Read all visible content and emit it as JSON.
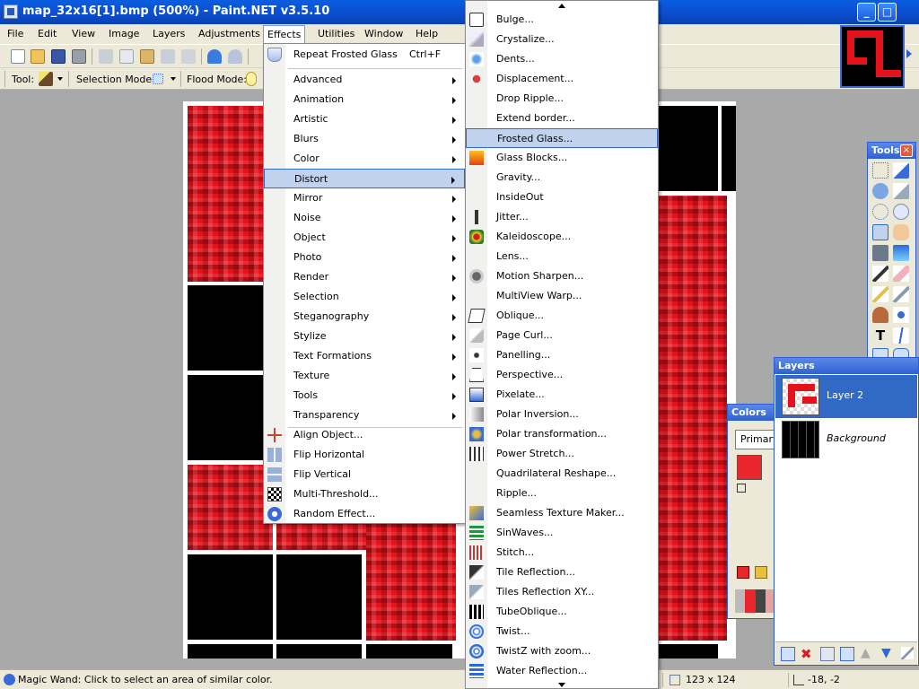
{
  "window": {
    "title": "map_32x16[1].bmp (500%) - Paint.NET v3.5.10",
    "minimize": "_",
    "maximize": "□"
  },
  "menubar": [
    "File",
    "Edit",
    "View",
    "Image",
    "Layers",
    "Adjustments",
    "Effects",
    "Utilities",
    "Window",
    "Help"
  ],
  "toolbar": {
    "tool_label": "Tool:",
    "selection_mode_label": "Selection Mode:",
    "flood_mode_label": "Flood Mode:"
  },
  "effects_menu": {
    "repeat": {
      "label": "Repeat Frosted Glass",
      "shortcut": "Ctrl+F"
    },
    "submenus": [
      "Advanced",
      "Animation",
      "Artistic",
      "Blurs",
      "Color",
      "Distort",
      "Mirror",
      "Noise",
      "Object",
      "Photo",
      "Render",
      "Selection",
      "Steganography",
      "Stylize",
      "Text Formations",
      "Texture",
      "Tools",
      "Transparency"
    ],
    "items": [
      "Align Object...",
      "Flip Horizontal",
      "Flip Vertical",
      "Multi-Threshold...",
      "Random Effect..."
    ],
    "highlighted": "Distort"
  },
  "distort_menu": {
    "items": [
      "Bulge...",
      "Crystalize...",
      "Dents...",
      "Displacement...",
      "Drop Ripple...",
      "Extend border...",
      "Frosted Glass...",
      "Glass Blocks...",
      "Gravity...",
      "InsideOut",
      "Jitter...",
      "Kaleidoscope...",
      "Lens...",
      "Motion Sharpen...",
      "MultiView Warp...",
      "Oblique...",
      "Page Curl...",
      "Panelling...",
      "Perspective...",
      "Pixelate...",
      "Polar Inversion...",
      "Polar transformation...",
      "Power Stretch...",
      "Quadrilateral Reshape...",
      "Ripple...",
      "Seamless Texture Maker...",
      "SinWaves...",
      "Stitch...",
      "Tile Reflection...",
      "Tiles Reflection XY...",
      "TubeOblique...",
      "Twist...",
      "TwistZ with zoom...",
      "Water Reflection..."
    ],
    "highlighted": "Frosted Glass..."
  },
  "tools_panel": {
    "title": "Tools",
    "close": "×"
  },
  "colors_panel": {
    "title": "Colors",
    "primary": "Primary",
    "primary_color": "#e8262b"
  },
  "layers_panel": {
    "title": "Layers",
    "layers": [
      {
        "name": "Layer 2",
        "selected": true
      },
      {
        "name": "Background",
        "selected": false
      }
    ]
  },
  "status": {
    "hint": "Magic Wand: Click to select an area of similar color.",
    "size": "123 x 124",
    "coords": "-18, -2"
  },
  "colors": {
    "accent": "#316ac5",
    "brand_red": "#e4121b",
    "menu_bg": "#ece9d8"
  }
}
